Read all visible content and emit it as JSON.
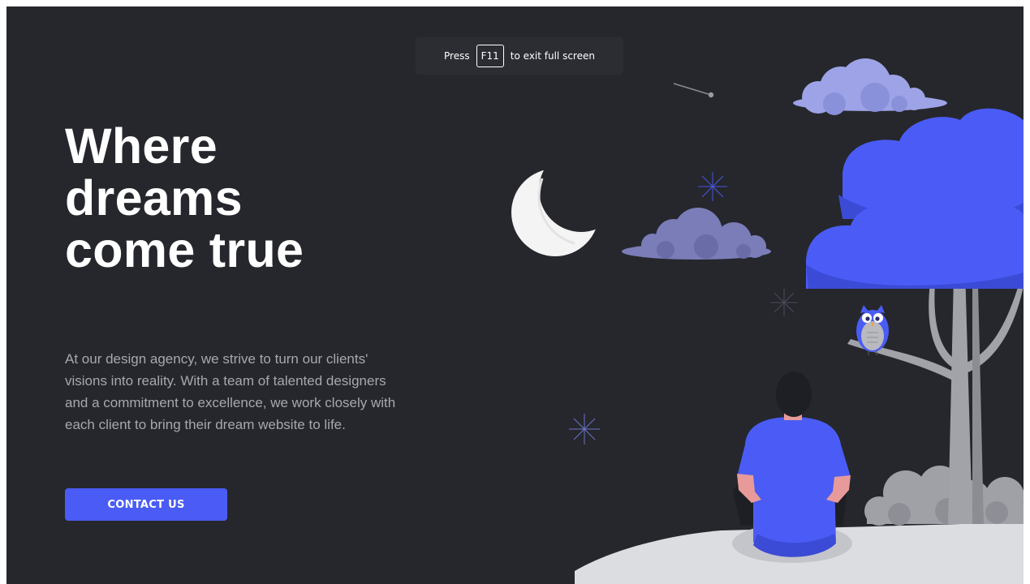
{
  "fullscreen_toast": {
    "press": "Press",
    "key": "F11",
    "rest": "to exit full screen"
  },
  "hero": {
    "title_lines": [
      "Where",
      "dreams",
      "come true"
    ],
    "description": "At our design agency, we strive to turn our clients' visions into reality. With a team of talented designers and a commitment to excellence, we work closely with each client to bring their dream website to life.",
    "cta_label": "CONTACT US"
  },
  "colors": {
    "background": "#26272c",
    "accent": "#4a5cf5",
    "text_primary": "#ffffff",
    "text_secondary": "#a7a7ad"
  }
}
